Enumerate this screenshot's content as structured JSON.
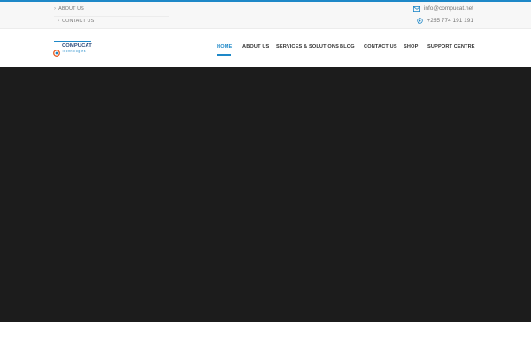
{
  "colors": {
    "accent": "#1e88c8",
    "hero_background": "#1c1c1c",
    "topbar_background": "#f7f7f7",
    "nav_text": "#333333",
    "logo_text": "#2b4a7a"
  },
  "topbar": {
    "links": [
      {
        "label": "ABOUT US",
        "icon": "chevron-right-icon"
      },
      {
        "label": "CONTACT US",
        "icon": "chevron-right-icon"
      }
    ],
    "email": {
      "icon": "envelope-icon",
      "text": "info@compucat.net"
    },
    "phone": {
      "icon": "whatsapp-icon",
      "text": "+255 774 191 191"
    }
  },
  "logo": {
    "name": "COMPUCAT",
    "tagline": "Technologies"
  },
  "nav": {
    "items": [
      {
        "label": "HOME",
        "active": true
      },
      {
        "label": "ABOUT US",
        "active": false
      },
      {
        "label": "SERVICES & SOLUTIONS",
        "active": false
      },
      {
        "label": "BLOG",
        "active": false
      },
      {
        "label": "CONTACT US",
        "active": false
      },
      {
        "label": "SHOP",
        "active": false
      },
      {
        "label": "SUPPORT CENTRE",
        "active": false
      }
    ]
  }
}
